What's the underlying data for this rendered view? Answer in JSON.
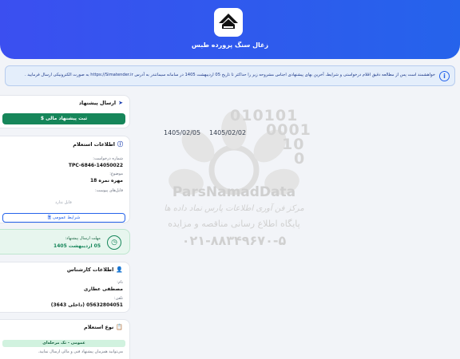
{
  "header": {
    "company_name": "زغال سنگ پرورده طبس"
  },
  "notice": {
    "text": "خواهشمند است پس از مطالعه دقیق اقلام درخواستی و شرایط، آخرین بهای پیشنهادی اجناس مشروحه زیر را حداکثر تا تاریخ 05 اردیبهشت 1405 در سامانه سیماتندر به آدرس https://Simatender.ir به صورت الکترونیکی ارسال فرمایید ."
  },
  "offer_card": {
    "title": "ارسال پیشنهاد",
    "submit_label": "ثبت پیشنهاد مالی"
  },
  "inquiry_card": {
    "title": "اطلاعات استعلام",
    "request_number_label": "شماره درخواست:",
    "request_number": "TPC-6846-14050022",
    "subject_label": "موضوع:",
    "subject": "مهره نمره 18",
    "attachments_label": "فایل‌های پیوست:",
    "no_file": "فایل ندارد",
    "terms_button": "شرایط عمومی"
  },
  "deadline": {
    "label": "مهلت ارسال پیشنهاد:",
    "date": "05 اردیبهشت 1405"
  },
  "expert_card": {
    "title": "اطلاعات کارشناس",
    "name_label": "نام:",
    "name": "مصطفی عطاری",
    "phone_label": "تلفن:",
    "phone": "05632804051 (داخلی 3643)"
  },
  "type_card": {
    "title": "نوع استعلام",
    "badge": "عمومی - تک مرحله‌ای",
    "description": "می‌توانید همزمان پیشنهاد فنی و مالی ارسال نمایید."
  },
  "dates": {
    "start": "1405/02/02",
    "end": "1405/02/05"
  },
  "watermark": {
    "binary_1": "010101",
    "binary_2": "0001",
    "binary_3": "10",
    "binary_4": "0",
    "brand": "ParsNamadData",
    "line_1": "مرکز فن آوری اطلاعات پارس نماد داده ها",
    "line_2": "پایگاه اطلاع رسانی مناقصه و مزایده",
    "phone": "۰۲۱-۸۸۳۴۹۶۷۰-۵"
  },
  "colors": {
    "primary": "#2563eb",
    "green": "#16865a",
    "notice_bg": "#e4eefb"
  }
}
